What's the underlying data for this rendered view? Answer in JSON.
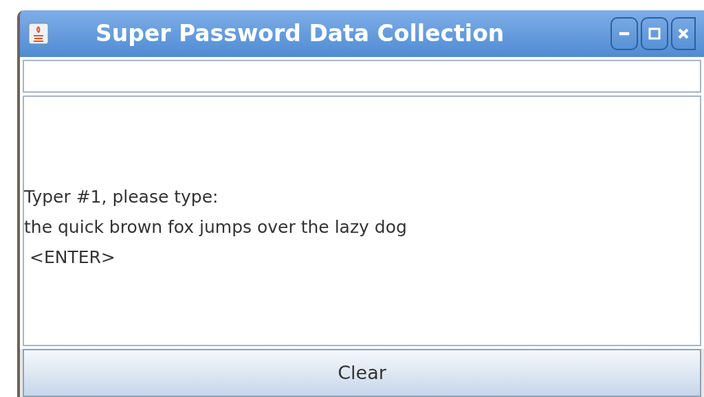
{
  "window": {
    "title": "Super Password Data Collection"
  },
  "text_area": {
    "lines": [
      "Typer #1, please type:",
      "the quick brown fox jumps over the lazy dog",
      " <ENTER>"
    ]
  },
  "buttons": [
    "Clear"
  ]
}
